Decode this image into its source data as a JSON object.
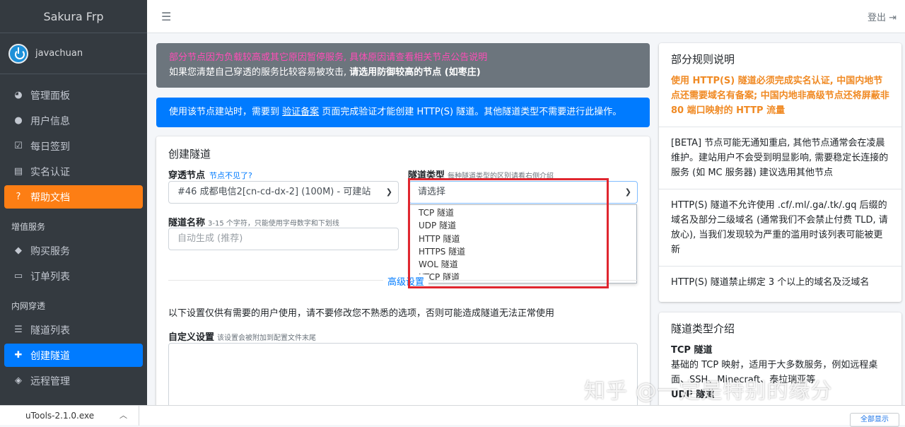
{
  "brand": "Sakura Frp",
  "user": {
    "name": "javachuan"
  },
  "nav": {
    "dashboard": "管理面板",
    "userinfo": "用户信息",
    "signin": "每日签到",
    "realname": "实名认证",
    "help": "帮助文档",
    "section_vas": "增值服务",
    "buy": "购买服务",
    "orders": "订单列表",
    "section_tunnel": "内网穿透",
    "tunnels": "隧道列表",
    "create": "创建隧道",
    "remote": "远程管理"
  },
  "topbar": {
    "logout": "登出"
  },
  "alert_grey": {
    "line1": "部分节点因为负载较高或其它原因暂停服务, 具体原因请查看相关节点公告说明",
    "line2_prefix": "如果您清楚自己穿透的服务比较容易被攻击,",
    "line2_bold": "请选用防御较高的节点 (如枣庄)"
  },
  "alert_blue": {
    "prefix": "使用该节点建站时，需要到",
    "link": "验证备案",
    "suffix": "页面完成验证才能创建 HTTP(S) 隧道。其他隧道类型不需要进行此操作。"
  },
  "form": {
    "title": "创建隧道",
    "node_label": "穿透节点",
    "node_missing": "节点不见了?",
    "node_value": "#46 成都电信2[cn-cd-dx-2] (100M) - 可建站",
    "type_label": "隧道类型",
    "type_hint": "每种隧道类型的区别请看右侧介绍",
    "type_placeholder": "请选择",
    "type_options": [
      "TCP 隧道",
      "UDP 隧道",
      "HTTP 隧道",
      "HTTPS 隧道",
      "WOL 隧道",
      "XTCP 隧道"
    ],
    "name_label": "隧道名称",
    "name_hint": "3-15 个字符，只能使用字母数字和下划线",
    "name_placeholder": "自动生成 (推荐)",
    "advanced": "高级设置",
    "advanced_note": "以下设置仅供有需要的用户使用，请不要修改您不熟悉的选项，否则可能造成隧道无法正常使用",
    "custom_label": "自定义设置",
    "custom_hint": "该设置会被附加到配置文件末尾"
  },
  "rules": {
    "title": "部分规则说明",
    "warn": "使用 HTTP(S) 隧道必须完成实名认证, 中国内地节点还需要域名有备案; 中国内地非高级节点还将屏蔽非 80 端口映射的 HTTP 流量",
    "beta": "[BETA] 节点可能无通知重启, 其他节点通常会在凌晨维护。建站用户不会受到明显影响, 需要稳定长连接的服务 (如 MC 服务器) 建议选用其他节点",
    "domains": "HTTP(S) 隧道不允许使用 .cf/.ml/.ga/.tk/.gq 后缀的域名及部分二级域名 (通常我们不会禁止付费 TLD, 请放心), 当我们发现较为严重的滥用时该列表可能被更新",
    "limit": "HTTP(S) 隧道禁止绑定 3 个以上的域名及泛域名"
  },
  "types_intro": {
    "title": "隧道类型介绍",
    "tcp_title": "TCP 隧道",
    "tcp_desc": "基础的 TCP 映射，适用于大多数服务，例如远程桌面、SSH、Minecraft、泰拉瑞亚等",
    "udp_title": "UDP 隧道"
  },
  "download": {
    "file": "uTools-2.1.0.exe",
    "show_all": "全部显示"
  },
  "watermark": "知乎 @一定是特别的缘分"
}
